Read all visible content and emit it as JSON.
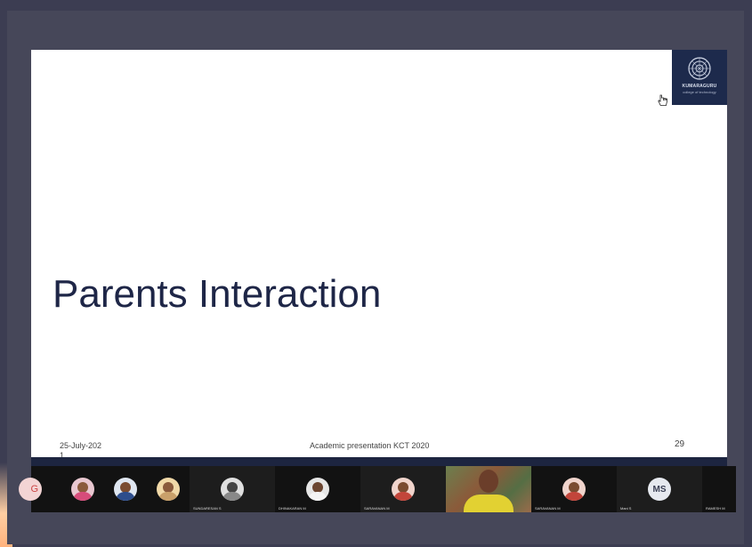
{
  "slide": {
    "title": "Parents Interaction",
    "footer_date": "25-July-202\n1",
    "footer_center": "Academic presentation KCT 2020",
    "page_number": "29",
    "logo_text": "KUMARAGURU",
    "logo_subtext": "college of technology"
  },
  "participants": [
    {
      "initial": "G",
      "name": ""
    },
    {
      "name": ""
    },
    {
      "name": ""
    },
    {
      "name": ""
    },
    {
      "name": "SUNDARESAN S"
    },
    {
      "name": "DHINAKARAN M"
    },
    {
      "name": "SARAVANAN M"
    },
    {
      "name": ""
    },
    {
      "name": "SARAVANAN M"
    },
    {
      "initials": "MS",
      "name": "Mani S"
    },
    {
      "name": "RAMESH M"
    }
  ],
  "colors": {
    "title": "#1e2647",
    "logo_bg": "#1d2a4c",
    "frame": "#464759"
  }
}
